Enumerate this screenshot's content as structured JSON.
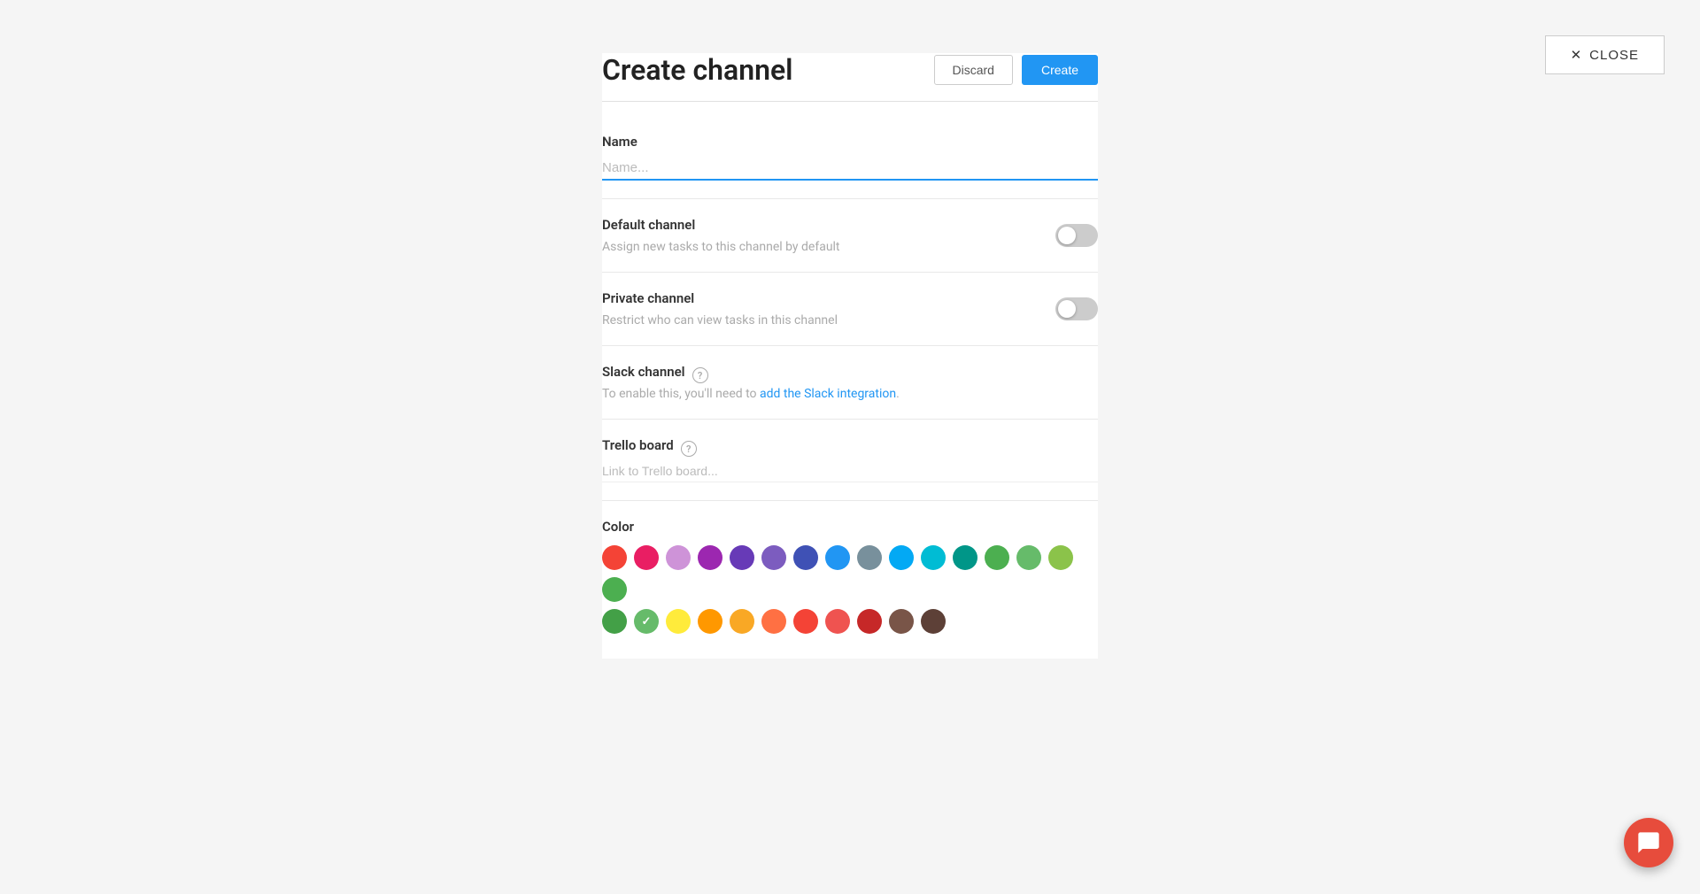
{
  "header": {
    "title": "Create channel",
    "close_label": "CLOSE",
    "discard_label": "Discard",
    "create_label": "Create"
  },
  "form": {
    "name_field": {
      "label": "Name",
      "placeholder": "Name..."
    },
    "default_channel": {
      "label": "Default channel",
      "description": "Assign new tasks to this channel by default",
      "enabled": false
    },
    "private_channel": {
      "label": "Private channel",
      "description": "Restrict who can view tasks in this channel",
      "enabled": false
    },
    "slack_channel": {
      "label": "Slack channel",
      "description_prefix": "To enable this, you'll need to ",
      "link_text": "add the Slack integration",
      "description_suffix": "."
    },
    "trello_board": {
      "label": "Trello board",
      "placeholder": "Link to Trello board..."
    },
    "color": {
      "label": "Color",
      "colors_row1": [
        "#f44336",
        "#e91e63",
        "#ce93d8",
        "#9c27b0",
        "#673ab7",
        "#7c5cbf",
        "#3f51b5",
        "#2196f3",
        "#78909c",
        "#03a9f4",
        "#00bcd4",
        "#009688",
        "#4caf50",
        "#66bb6a",
        "#8bc34a",
        "#4caf50"
      ],
      "colors_row2": [
        "#43a047",
        "#66bb6a",
        "#ffeb3b",
        "#ff9800",
        "#f9a825",
        "#ff7043",
        "#f44336",
        "#ef5350",
        "#c62828",
        "#795548",
        "#5d4037"
      ]
    }
  }
}
